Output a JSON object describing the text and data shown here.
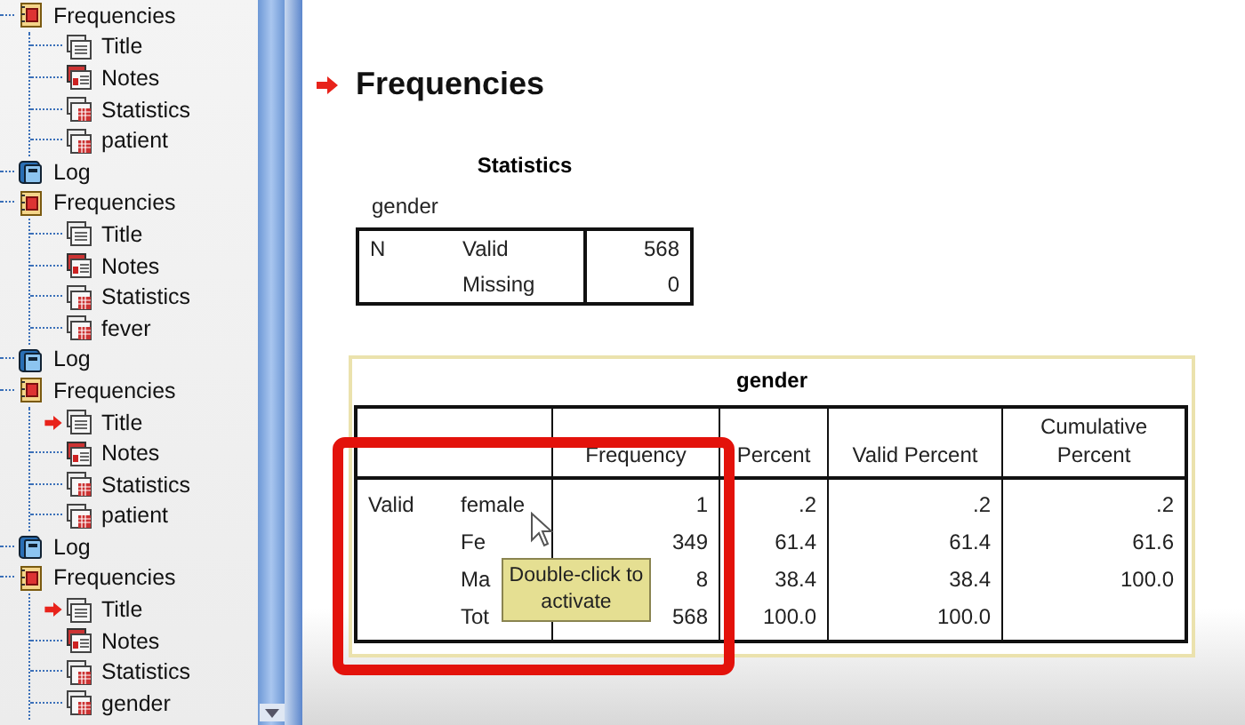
{
  "outline": {
    "items": [
      {
        "kind": "procedure",
        "label": "Frequencies",
        "current": false,
        "children": [
          {
            "kind": "title",
            "label": "Title",
            "current": false
          },
          {
            "kind": "notes",
            "label": "Notes",
            "current": false
          },
          {
            "kind": "table",
            "label": "Statistics",
            "current": false
          },
          {
            "kind": "table",
            "label": "patient",
            "current": false
          }
        ]
      },
      {
        "kind": "log",
        "label": "Log",
        "current": false
      },
      {
        "kind": "procedure",
        "label": "Frequencies",
        "current": false,
        "children": [
          {
            "kind": "title",
            "label": "Title",
            "current": false
          },
          {
            "kind": "notes",
            "label": "Notes",
            "current": false
          },
          {
            "kind": "table",
            "label": "Statistics",
            "current": false
          },
          {
            "kind": "table",
            "label": "fever",
            "current": false
          }
        ]
      },
      {
        "kind": "log",
        "label": "Log",
        "current": false
      },
      {
        "kind": "procedure",
        "label": "Frequencies",
        "current": false,
        "children": [
          {
            "kind": "title",
            "label": "Title",
            "current": true
          },
          {
            "kind": "notes",
            "label": "Notes",
            "current": false
          },
          {
            "kind": "table",
            "label": "Statistics",
            "current": false
          },
          {
            "kind": "table",
            "label": "patient",
            "current": false
          }
        ]
      },
      {
        "kind": "log",
        "label": "Log",
        "current": false
      },
      {
        "kind": "procedure",
        "label": "Frequencies",
        "current": false,
        "children": [
          {
            "kind": "title",
            "label": "Title",
            "current": true
          },
          {
            "kind": "notes",
            "label": "Notes",
            "current": false
          },
          {
            "kind": "table",
            "label": "Statistics",
            "current": false
          },
          {
            "kind": "table",
            "label": "gender",
            "current": false
          }
        ]
      }
    ]
  },
  "heading": {
    "text": "Frequencies",
    "current": true
  },
  "statistics_table": {
    "title": "Statistics",
    "variable": "gender",
    "rows": [
      {
        "group": "N",
        "label": "Valid",
        "value": "568"
      },
      {
        "label": "Missing",
        "value": "0"
      }
    ]
  },
  "frequency_table": {
    "title": "gender",
    "columns": [
      "Frequency",
      "Percent",
      "Valid Percent",
      "Cumulative Percent"
    ],
    "rows": [
      {
        "group": "Valid",
        "label": "female",
        "values": [
          "1",
          ".2",
          ".2",
          ".2"
        ]
      },
      {
        "label": "Fe",
        "values": [
          "349",
          "61.4",
          "61.4",
          "61.6"
        ]
      },
      {
        "label": "Ma",
        "values": [
          "8",
          "38.4",
          "38.4",
          "100.0"
        ]
      },
      {
        "label": "Tot",
        "values": [
          "568",
          "100.0",
          "100.0"
        ]
      }
    ]
  },
  "tooltip": {
    "text": "Double-click to activate"
  }
}
